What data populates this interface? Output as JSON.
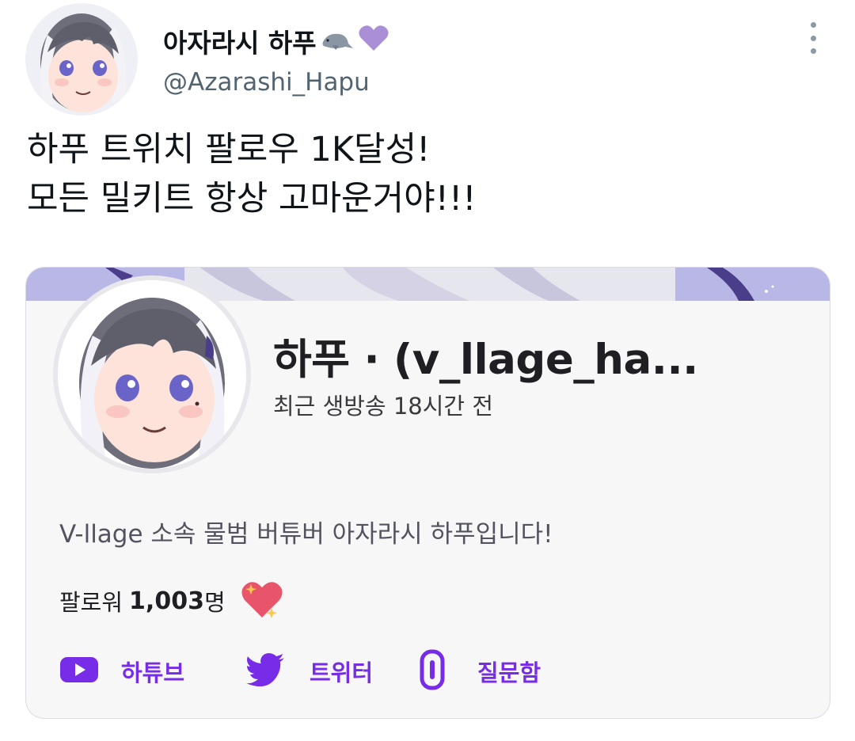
{
  "tweet": {
    "author_name": "아자라시 하푸",
    "author_emojis": [
      "seal-emoji",
      "purple-heart-emoji"
    ],
    "handle": "@Azarashi_Hapu",
    "text_line_1": "하푸 트위치 팔로우 1K달성!",
    "text_line_2": "모든 밀키트 항상 고마운거야!!!"
  },
  "card": {
    "channel_title": "하푸 · (v_llage_ha...",
    "last_live": "최근 생방송 18시간 전",
    "bio": "V-llage 소속 물범 버튜버 아자라시 하푸입니다!",
    "followers_label": "팔로워",
    "followers_count": "1,003",
    "followers_unit": "명",
    "links": [
      {
        "label": "하튜브",
        "icon": "youtube-icon"
      },
      {
        "label": "트위터",
        "icon": "twitter-icon"
      },
      {
        "label": "질문함",
        "icon": "question-box-icon"
      }
    ],
    "colors": {
      "link": "#772ce8",
      "banner": "#b9b7e6",
      "card_bg": "#f7f7f8"
    }
  }
}
